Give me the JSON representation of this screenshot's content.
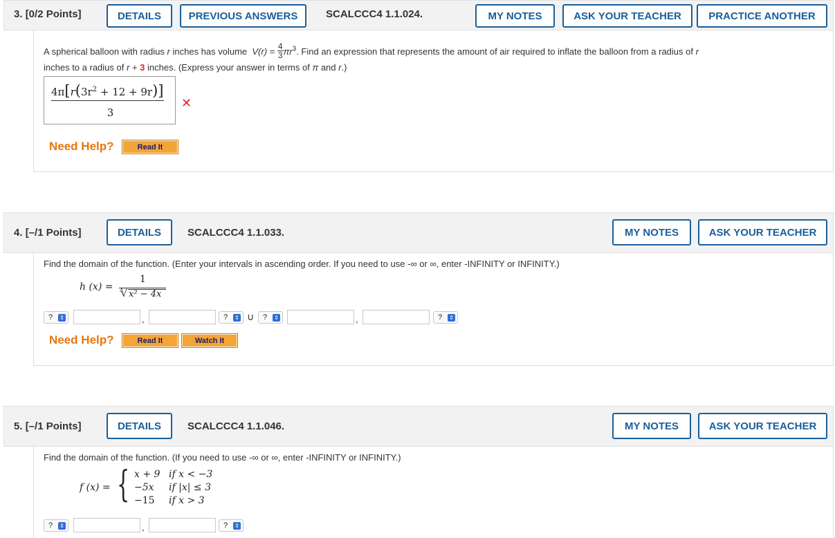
{
  "q3": {
    "number": "3.",
    "points": "[0/2 Points]",
    "details": "DETAILS",
    "previous_answers": "PREVIOUS ANSWERS",
    "code": "SCALCCC4 1.1.024.",
    "my_notes": "MY NOTES",
    "ask_teacher": "ASK YOUR TEACHER",
    "practice": "PRACTICE ANOTHER",
    "text_a": "A spherical balloon with radius",
    "var_r": "r",
    "text_b": "inches has volume",
    "vr": "V(r)",
    "eq": "=",
    "frac_num": "4",
    "frac_den": "3",
    "pi_r3": "πr",
    "cube": "3",
    "text_c": ". Find an expression that represents the amount of air required to inflate the balloon from a radius of",
    "text_d": "inches to a radius of",
    "plus": "+",
    "three": "3",
    "text_e": "inches. (Express your answer in terms of",
    "pi": "π",
    "and": "and",
    "text_f": ".)",
    "answer_num_a": "4π",
    "answer_num_b": "r",
    "answer_num_c": "3r",
    "answer_sq": "2",
    "answer_num_d": "+ 12 + 9r",
    "answer_den": "3",
    "incorrect_mark": "✕",
    "need_help": "Need Help?",
    "read_it": "Read It"
  },
  "q4": {
    "number": "4.",
    "points": "[–/1 Points]",
    "details": "DETAILS",
    "code": "SCALCCC4 1.1.033.",
    "my_notes": "MY NOTES",
    "ask_teacher": "ASK YOUR TEACHER",
    "instructions": "Find the domain of the function. (Enter your intervals in ascending order. If you need to use -∞ or ∞, enter -INFINITY or INFINITY.)",
    "func_lhs": "h (x) =",
    "func_num": "1",
    "root_index": "4",
    "func_den": "x² − 4x",
    "select_value": "?",
    "comma": ",",
    "union": "∪",
    "need_help": "Need Help?",
    "read_it": "Read It",
    "watch_it": "Watch It"
  },
  "q5": {
    "number": "5.",
    "points": "[–/1 Points]",
    "details": "DETAILS",
    "code": "SCALCCC4 1.1.046.",
    "my_notes": "MY NOTES",
    "ask_teacher": "ASK YOUR TEACHER",
    "instructions": "Find the domain of the function. (If you need to use -∞ or ∞, enter -INFINITY or INFINITY.)",
    "func_lhs": "f (x) =",
    "cases": [
      {
        "expr": "x + 9",
        "cond": "if x < −3"
      },
      {
        "expr": "−5x",
        "cond": "if |x| ≤ 3"
      },
      {
        "expr": "−15",
        "cond": "if x > 3"
      }
    ],
    "select_value": "?",
    "comma": ","
  },
  "colors": {
    "accent": "#1a5e9a",
    "header_bg": "#f2f2f2",
    "help_orange": "#e6750f",
    "button_orange": "#f3a538",
    "incorrect_red": "#e11d2a",
    "select_blue": "#2e6fd8"
  }
}
